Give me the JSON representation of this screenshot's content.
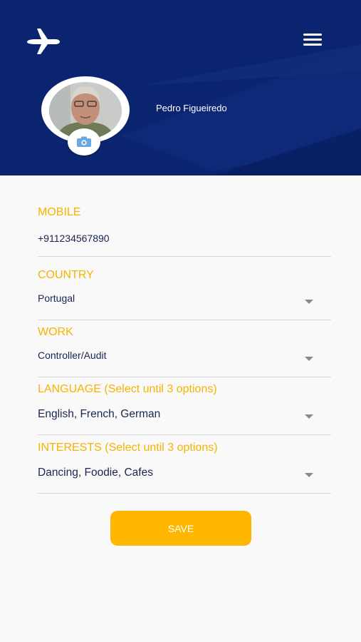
{
  "header": {
    "user_name": "Pedro Figueiredo"
  },
  "colors": {
    "header_bg": "#0a2470",
    "accent": "#f6b400",
    "button": "#feb601",
    "value_text": "#1b2452"
  },
  "icons": {
    "logo": "plane-icon",
    "menu": "hamburger-menu-icon",
    "camera": "camera-icon",
    "dropdown": "caret-down-icon"
  },
  "form": {
    "mobile": {
      "label": "MOBILE",
      "value": "+911234567890"
    },
    "country": {
      "label": "COUNTRY",
      "value": "Portugal"
    },
    "work": {
      "label": "WORK",
      "value": "Controller/Audit"
    },
    "language": {
      "label": "LANGUAGE (Select until 3 options)",
      "value": "English, French, German"
    },
    "interests": {
      "label": "INTERESTS (Select until 3 options)",
      "value": "Dancing, Foodie, Cafes"
    }
  },
  "actions": {
    "save_label": "SAVE"
  }
}
